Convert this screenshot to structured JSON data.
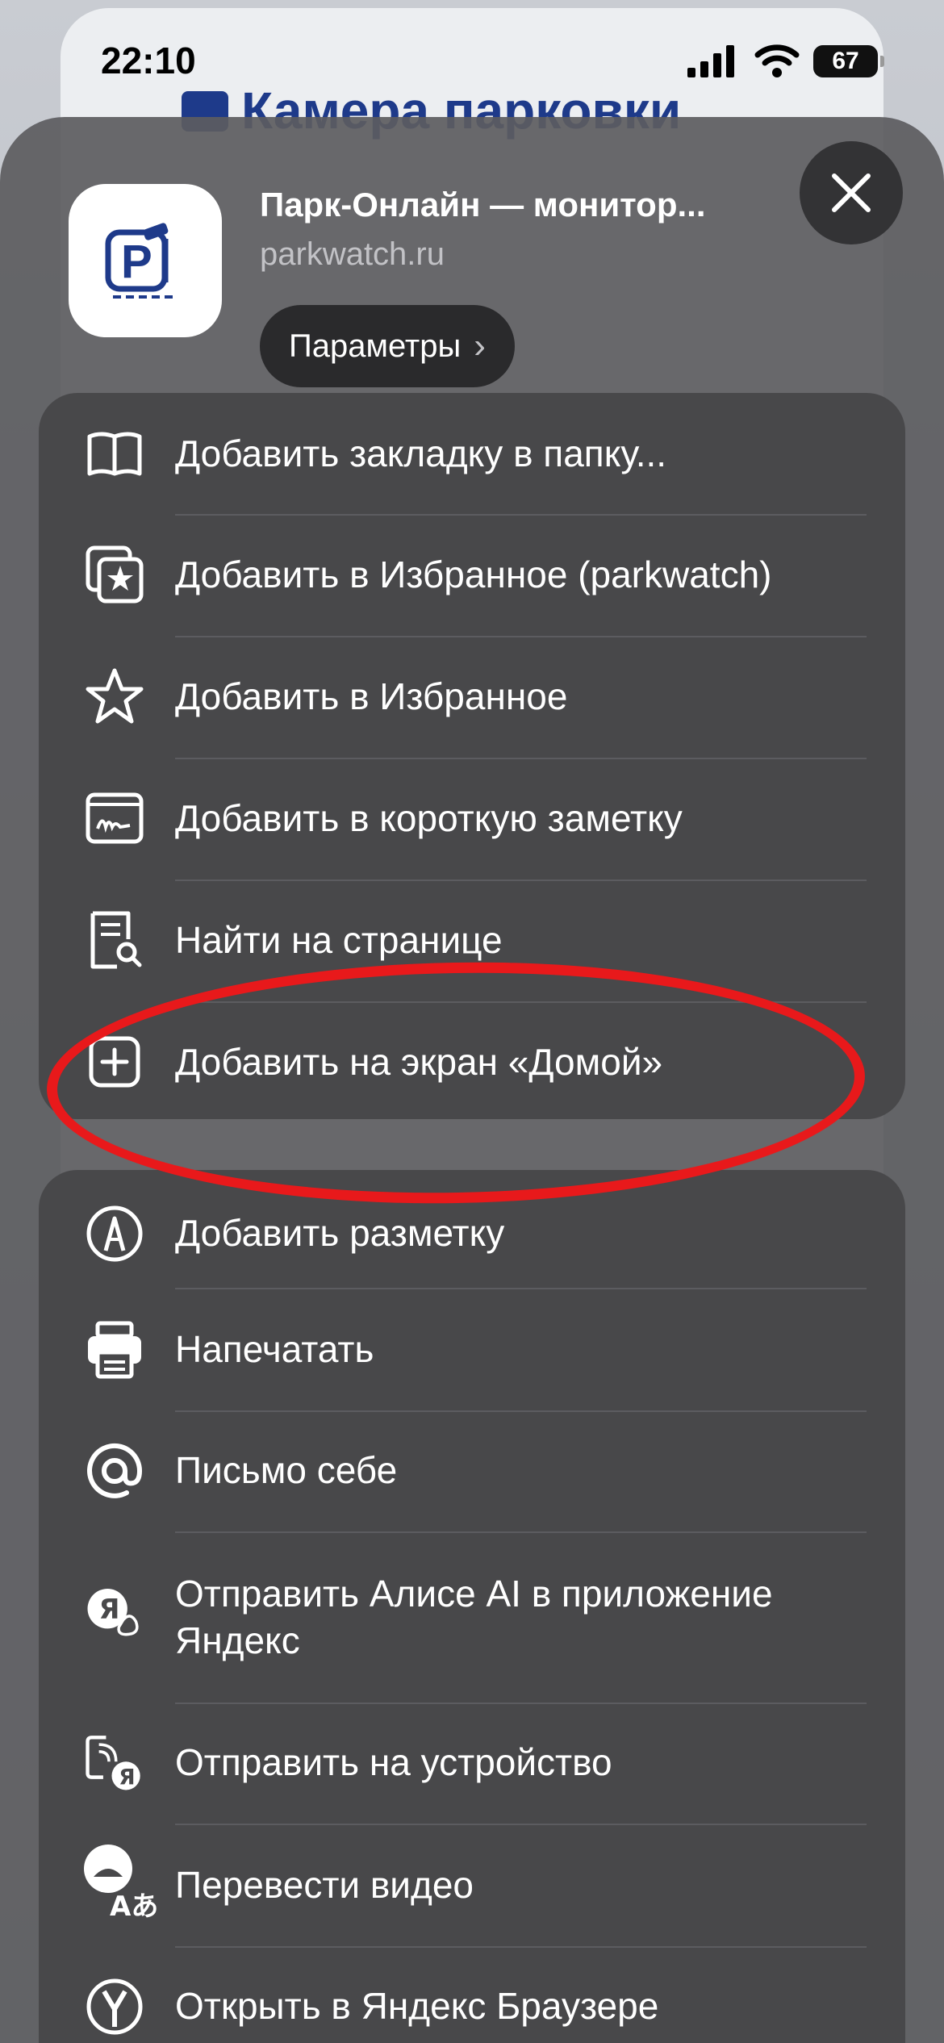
{
  "status_bar": {
    "time": "22:10",
    "battery": "67"
  },
  "background_page": {
    "title": "Камера парковки"
  },
  "share_sheet": {
    "app_title": "Парк-Онлайн — монитор...",
    "url": "parkwatch.ru",
    "params_label": "Параметры",
    "params_chevron": "›",
    "app_icon_letter": "P",
    "close_label": "✕",
    "group1": [
      {
        "icon": "book-icon",
        "label": "Добавить закладку в папку..."
      },
      {
        "icon": "star-square-icon",
        "label": "Добавить в Избранное (parkwatch)"
      },
      {
        "icon": "star-icon",
        "label": "Добавить в Избранное"
      },
      {
        "icon": "quick-note-icon",
        "label": "Добавить в короткую заметку"
      },
      {
        "icon": "find-on-page-icon",
        "label": "Найти на странице"
      },
      {
        "icon": "plus-square-icon",
        "label": "Добавить на экран «Домой»"
      }
    ],
    "group2": [
      {
        "icon": "markup-icon",
        "label": "Добавить разметку"
      },
      {
        "icon": "printer-icon",
        "label": "Напечатать"
      },
      {
        "icon": "at-icon",
        "label": "Письмо себе"
      },
      {
        "icon": "alice-icon",
        "label": "Отправить Алисе AI в приложение Яндекс"
      },
      {
        "icon": "send-device-icon",
        "label": "Отправить на устройство"
      },
      {
        "icon": "translate-video-icon",
        "label": "Перевести видео"
      },
      {
        "icon": "yandex-browser-icon",
        "label": "Открыть в Яндекс Браузере"
      }
    ],
    "alice_badge": "Я",
    "translate_badge": "Aあ"
  },
  "colors": {
    "sheet_background": "#5c5c60",
    "group_background": "#48484a",
    "highlight": "#e8191b",
    "app_icon_brand": "#1e3a8a"
  }
}
